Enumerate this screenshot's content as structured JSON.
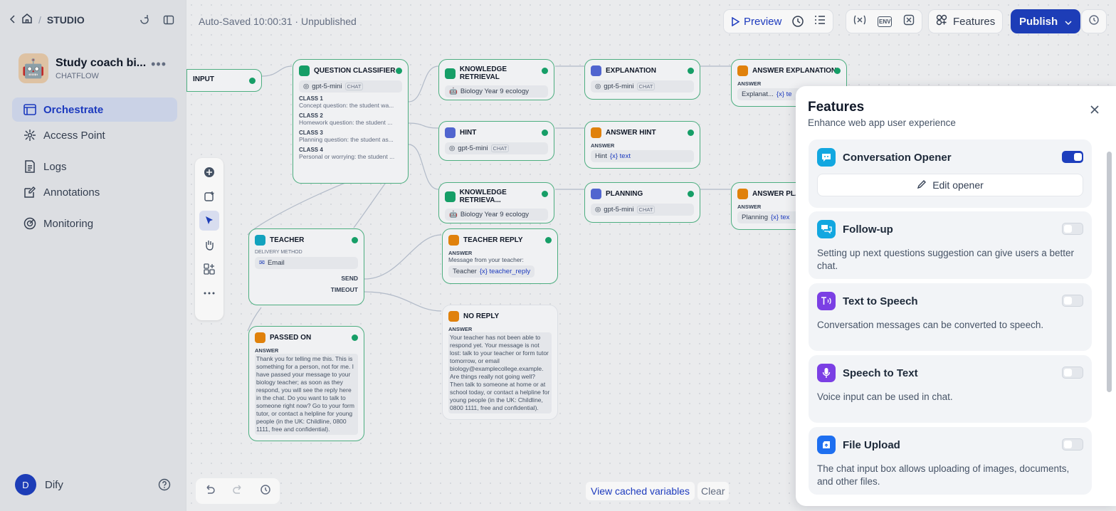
{
  "header": {
    "studio_label": "STUDIO",
    "status": "Auto-Saved 10:00:31 · Unpublished",
    "preview_label": "Preview",
    "features_label": "Features",
    "publish_label": "Publish",
    "env_label": "ENV"
  },
  "app": {
    "name": "Study coach bi...",
    "mode": "CHATFLOW",
    "avatar": "🤖"
  },
  "nav": [
    {
      "label": "Orchestrate",
      "active": true
    },
    {
      "label": "Access Point"
    },
    {
      "label": "Logs"
    },
    {
      "label": "Annotations"
    },
    {
      "label": "Monitoring"
    }
  ],
  "user": {
    "initial": "D",
    "name": "Dify"
  },
  "nodes": {
    "input": {
      "title": "INPUT"
    },
    "classifier": {
      "title": "QUESTION CLASSIFIER",
      "model": "gpt-5-mini",
      "chip": "CHAT",
      "classes": [
        {
          "label": "CLASS 1",
          "text": "Concept question: the student wa..."
        },
        {
          "label": "CLASS 2",
          "text": "Homework question: the student ..."
        },
        {
          "label": "CLASS 3",
          "text": "Planning question: the student as..."
        },
        {
          "label": "CLASS 4",
          "text": "Personal or worrying: the student ..."
        }
      ]
    },
    "kr1": {
      "title": "KNOWLEDGE RETRIEVAL",
      "kb": "Biology Year 9 ecology"
    },
    "kr2": {
      "title": "KNOWLEDGE RETRIEVA...",
      "kb": "Biology Year 9 ecology"
    },
    "hint": {
      "title": "HINT",
      "model": "gpt-5-mini",
      "chip": "CHAT"
    },
    "explanation": {
      "title": "EXPLANATION",
      "model": "gpt-5-mini",
      "chip": "CHAT"
    },
    "planning": {
      "title": "PLANNING",
      "model": "gpt-5-mini",
      "chip": "CHAT"
    },
    "answer_explanation": {
      "title": "ANSWER EXPLANATION",
      "label": "ANSWER",
      "ref": "Explanat...",
      "var": "{x} te"
    },
    "answer_hint": {
      "title": "ANSWER HINT",
      "label": "ANSWER",
      "ref": "Hint",
      "var": "{x} text"
    },
    "answer_plan": {
      "title": "ANSWER PLAN",
      "label": "ANSWER",
      "ref": "Planning",
      "var": "{x} tex"
    },
    "teacher": {
      "title": "TEACHER",
      "delivery_label": "DELIVERY METHOD",
      "method": "Email",
      "send": "SEND",
      "timeout": "TIMEOUT"
    },
    "teacher_reply": {
      "title": "TEACHER REPLY",
      "label": "ANSWER",
      "text": "Message from your teacher:",
      "ref": "Teacher",
      "var": "{x} teacher_reply"
    },
    "passed_on": {
      "title": "PASSED ON",
      "label": "ANSWER",
      "text": "Thank you for telling me this. This is something for a person, not for me. I have passed your message to your biology teacher; as soon as they respond, you will see the reply here in the chat. Do you want to talk to someone right now? Go to your form tutor, or contact a helpline for young people (in the UK: Childline, 0800 1111, free and confidential)."
    },
    "no_reply": {
      "title": "NO REPLY",
      "label": "ANSWER",
      "text": "Your teacher has not been able to respond yet. Your message is not lost: talk to your teacher or form tutor tomorrow, or email biology@examplecollege.example. Are things really not going well? Then talk to someone at home or at school today, or contact a helpline for young people (in the UK: Childline, 0800 1111, free and confidential)."
    }
  },
  "canvas": {
    "view_cached": "View cached variables",
    "clear": "Clear"
  },
  "features": {
    "title": "Features",
    "subtitle": "Enhance web app user experience",
    "edit_opener": "Edit opener",
    "items": [
      {
        "title": "Conversation Opener",
        "enabled": true,
        "color": "#12a7e0",
        "icon": "chat-bubble-icon"
      },
      {
        "title": "Follow-up",
        "desc": "Setting up next questions suggestion can give users a better chat.",
        "enabled": false,
        "color": "#12a7e0",
        "icon": "follow-up-icon"
      },
      {
        "title": "Text to Speech",
        "desc": "Conversation messages can be converted to speech.",
        "enabled": false,
        "color": "#7b3fe4",
        "icon": "text-to-speech-icon"
      },
      {
        "title": "Speech to Text",
        "desc": "Voice input can be used in chat.",
        "enabled": false,
        "color": "#7b3fe4",
        "icon": "microphone-icon"
      },
      {
        "title": "File Upload",
        "desc": "The chat input box allows uploading of images, documents, and other files.",
        "enabled": false,
        "color": "#1e6ff0",
        "icon": "file-upload-icon"
      }
    ]
  }
}
